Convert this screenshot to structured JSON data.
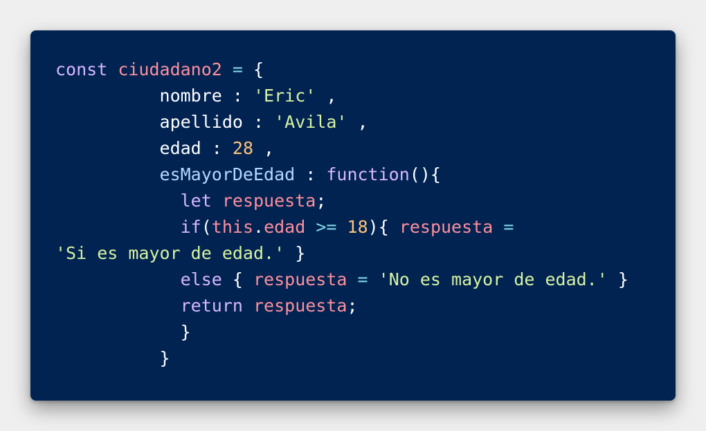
{
  "colors": {
    "page_background": "#efefef",
    "code_background": "#012352",
    "keyword": "#d8b7ff",
    "variable": "#ff8f9c",
    "operator": "#82d8e8",
    "string": "#d7f3a0",
    "number": "#ffc37a",
    "property": "#ffffff",
    "function_name": "#b6d7ff"
  },
  "code_block": {
    "lines": [
      {
        "tokens": [
          {
            "text": "const",
            "type": "kw"
          },
          {
            "text": " ",
            "type": "plain"
          },
          {
            "text": "ciudadano2",
            "type": "var"
          },
          {
            "text": " ",
            "type": "plain"
          },
          {
            "text": "=",
            "type": "op"
          },
          {
            "text": " ",
            "type": "plain"
          },
          {
            "text": "{",
            "type": "punc"
          }
        ]
      },
      {
        "tokens": [
          {
            "text": "          ",
            "type": "plain"
          },
          {
            "text": "nombre",
            "type": "prop"
          },
          {
            "text": " : ",
            "type": "punc"
          },
          {
            "text": "'Eric'",
            "type": "str"
          },
          {
            "text": " ,",
            "type": "punc"
          }
        ]
      },
      {
        "tokens": [
          {
            "text": "          ",
            "type": "plain"
          },
          {
            "text": "apellido",
            "type": "prop"
          },
          {
            "text": " : ",
            "type": "punc"
          },
          {
            "text": "'Avila'",
            "type": "str"
          },
          {
            "text": " ,",
            "type": "punc"
          }
        ]
      },
      {
        "tokens": [
          {
            "text": "          ",
            "type": "plain"
          },
          {
            "text": "edad",
            "type": "prop"
          },
          {
            "text": " : ",
            "type": "punc"
          },
          {
            "text": "28",
            "type": "num"
          },
          {
            "text": " ,",
            "type": "punc"
          }
        ]
      },
      {
        "tokens": [
          {
            "text": "          ",
            "type": "plain"
          },
          {
            "text": "esMayorDeEdad",
            "type": "func"
          },
          {
            "text": " : ",
            "type": "punc"
          },
          {
            "text": "function",
            "type": "kw"
          },
          {
            "text": "(){",
            "type": "punc"
          }
        ]
      },
      {
        "tokens": [
          {
            "text": "            ",
            "type": "plain"
          },
          {
            "text": "let",
            "type": "kw"
          },
          {
            "text": " ",
            "type": "plain"
          },
          {
            "text": "respuesta",
            "type": "var"
          },
          {
            "text": ";",
            "type": "punc"
          }
        ]
      },
      {
        "tokens": [
          {
            "text": "            ",
            "type": "plain"
          },
          {
            "text": "if",
            "type": "kw"
          },
          {
            "text": "(",
            "type": "punc"
          },
          {
            "text": "this",
            "type": "var"
          },
          {
            "text": ".",
            "type": "punc"
          },
          {
            "text": "edad",
            "type": "var"
          },
          {
            "text": " ",
            "type": "plain"
          },
          {
            "text": ">=",
            "type": "op"
          },
          {
            "text": " ",
            "type": "plain"
          },
          {
            "text": "18",
            "type": "num"
          },
          {
            "text": "){ ",
            "type": "punc"
          },
          {
            "text": "respuesta",
            "type": "var"
          },
          {
            "text": " ",
            "type": "plain"
          },
          {
            "text": "=",
            "type": "op"
          }
        ]
      },
      {
        "tokens": [
          {
            "text": "'Si es mayor de edad.'",
            "type": "str"
          },
          {
            "text": " }",
            "type": "punc"
          }
        ]
      },
      {
        "tokens": [
          {
            "text": "            ",
            "type": "plain"
          },
          {
            "text": "else",
            "type": "kw"
          },
          {
            "text": " { ",
            "type": "punc"
          },
          {
            "text": "respuesta",
            "type": "var"
          },
          {
            "text": " ",
            "type": "plain"
          },
          {
            "text": "=",
            "type": "op"
          },
          {
            "text": " ",
            "type": "plain"
          },
          {
            "text": "'No es mayor de edad.'",
            "type": "str"
          },
          {
            "text": " }",
            "type": "punc"
          }
        ]
      },
      {
        "tokens": [
          {
            "text": "            ",
            "type": "plain"
          },
          {
            "text": "return",
            "type": "kw"
          },
          {
            "text": " ",
            "type": "plain"
          },
          {
            "text": "respuesta",
            "type": "var"
          },
          {
            "text": ";",
            "type": "punc"
          }
        ]
      },
      {
        "tokens": [
          {
            "text": "            ",
            "type": "plain"
          },
          {
            "text": "}",
            "type": "punc"
          }
        ]
      },
      {
        "tokens": [
          {
            "text": "          ",
            "type": "plain"
          },
          {
            "text": "}",
            "type": "punc"
          }
        ]
      }
    ]
  }
}
